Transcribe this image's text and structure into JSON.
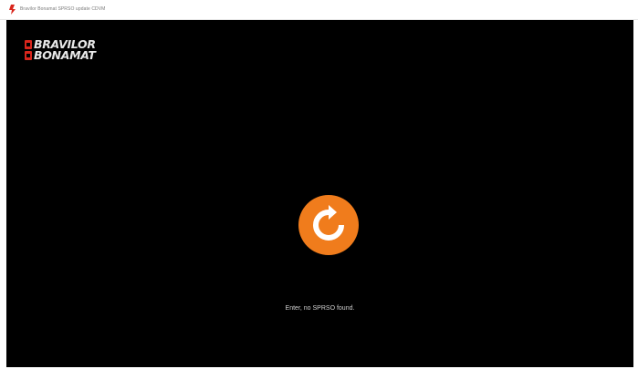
{
  "window": {
    "title": "Bravilor Bonamat SPRSO update CDVM"
  },
  "brand": {
    "line1": "BRAVILOR",
    "line2": "BONAMAT",
    "accent_color": "#d9261c"
  },
  "main": {
    "spinner_icon": "refresh-icon",
    "spinner_color": "#f07c1c",
    "status_text": "Enter, no SPRSO found."
  }
}
